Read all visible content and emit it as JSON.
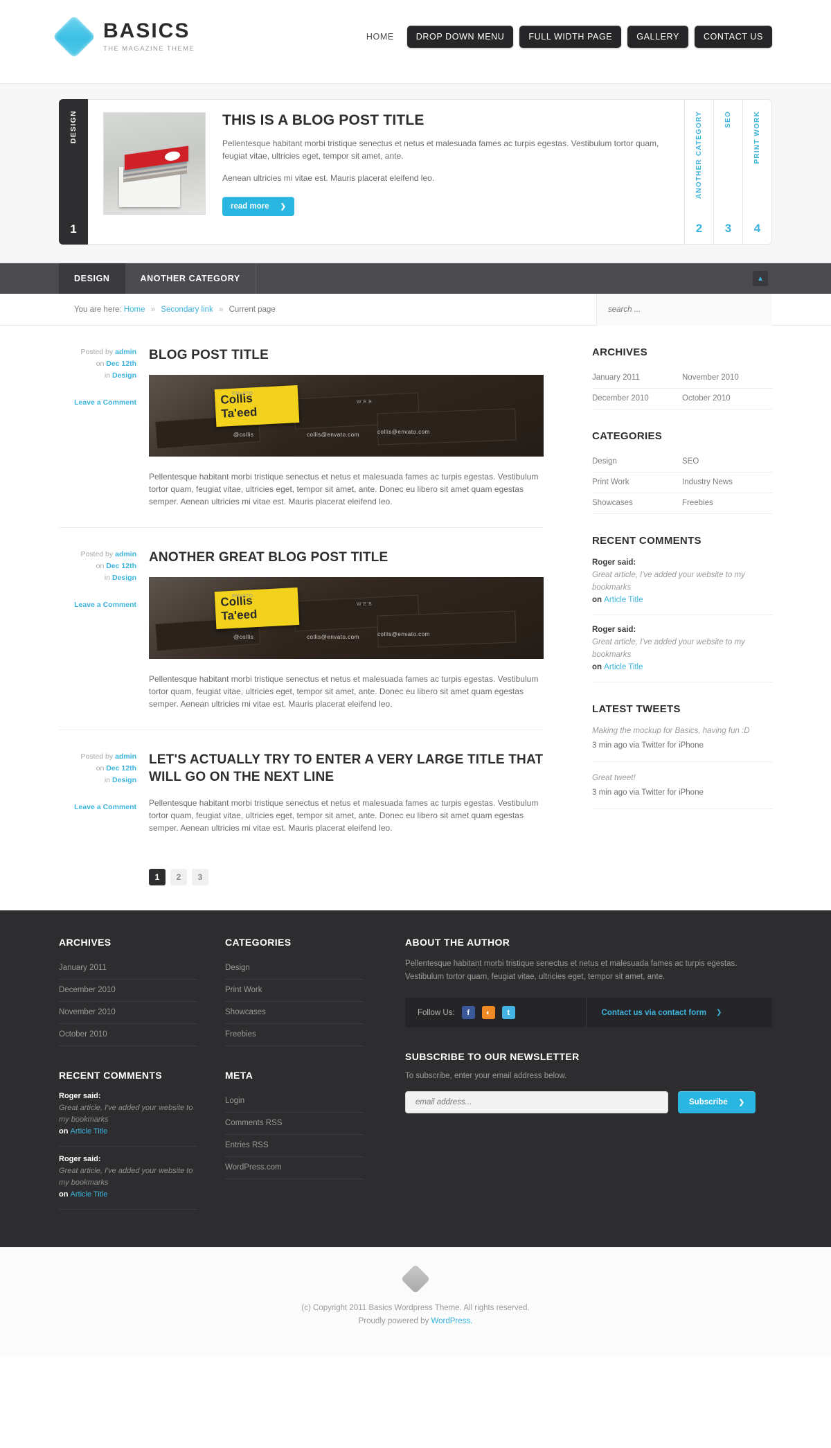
{
  "header": {
    "brand_title": "BASICS",
    "brand_sub": "THE MAGAZINE THEME",
    "logo_icon": "diamond-logo-icon",
    "nav": [
      {
        "label": "HOME",
        "style": "plain"
      },
      {
        "label": "DROP DOWN MENU",
        "style": "button"
      },
      {
        "label": "FULL WIDTH PAGE",
        "style": "button"
      },
      {
        "label": "GALLERY",
        "style": "button"
      },
      {
        "label": "CONTACT US",
        "style": "button"
      }
    ]
  },
  "featured": {
    "active_tab": {
      "label": "DESIGN",
      "number": "1"
    },
    "slide": {
      "title": "THIS IS A BLOG POST TITLE",
      "paragraph1": "Pellentesque habitant morbi tristique senectus et netus et malesuada fames ac turpis egestas. Vestibulum tortor quam, feugiat vitae, ultricies eget, tempor sit amet, ante.",
      "paragraph2": "Aenean ultricies mi vitae est. Mauris placerat eleifend leo.",
      "read_more": "read more",
      "arrow_icon": "chevron-right-icon",
      "thumb_alt": "stack-of-business-cards-image"
    },
    "side_tabs": [
      {
        "label": "ANOTHER CATEGORY",
        "number": "2"
      },
      {
        "label": "SEO",
        "number": "3"
      },
      {
        "label": "PRINT WORK",
        "number": "4"
      }
    ]
  },
  "category_bar": {
    "items": [
      {
        "label": "DESIGN",
        "active": true
      },
      {
        "label": "ANOTHER CATEGORY",
        "active": false
      }
    ],
    "toggle_icon": "chevron-up-icon"
  },
  "breadcrumb": {
    "prefix": "You are here:",
    "home": "Home",
    "secondary": "Secondary link",
    "current": "Current page",
    "separator": "»"
  },
  "search": {
    "placeholder": "search ...",
    "value": "",
    "icon": "search-icon"
  },
  "posts": [
    {
      "meta_posted_by": "Posted by",
      "author": "admin",
      "meta_on": "on",
      "date": "Dec 12th",
      "meta_in": "in",
      "category": "Design",
      "comment_link": "Leave a Comment",
      "title": "BLOG POST TITLE",
      "has_image": true,
      "image_alt": "collis-taeed-business-cards-image",
      "body": "Pellentesque habitant morbi tristique senectus et netus et malesuada fames ac turpis egestas. Vestibulum tortor quam, feugiat vitae, ultricies eget, tempor sit amet, ante. Donec eu libero sit amet quam egestas semper. Aenean ultricies mi vitae est. Mauris placerat eleifend leo."
    },
    {
      "meta_posted_by": "Posted by",
      "author": "admin",
      "meta_on": "on",
      "date": "Dec 12th",
      "meta_in": "in",
      "category": "Design",
      "comment_link": "Leave a Comment",
      "title": "ANOTHER GREAT BLOG POST TITLE",
      "has_image": true,
      "image_alt": "collis-taeed-business-cards-image",
      "body": "Pellentesque habitant morbi tristique senectus et netus et malesuada fames ac turpis egestas. Vestibulum tortor quam, feugiat vitae, ultricies eget, tempor sit amet, ante. Donec eu libero sit amet quam egestas semper. Aenean ultricies mi vitae est. Mauris placerat eleifend leo."
    },
    {
      "meta_posted_by": "Posted by",
      "author": "admin",
      "meta_on": "on",
      "date": "Dec 12th",
      "meta_in": "in",
      "category": "Design",
      "comment_link": "Leave a Comment",
      "title": "LET'S ACTUALLY TRY TO ENTER A VERY LARGE TITLE THAT WILL GO ON THE NEXT LINE",
      "has_image": false,
      "image_alt": "",
      "body": "Pellentesque habitant morbi tristique senectus et netus et malesuada fames ac turpis egestas. Vestibulum tortor quam, feugiat vitae, ultricies eget, tempor sit amet, ante. Donec eu libero sit amet quam egestas semper. Aenean ultricies mi vitae est. Mauris placerat eleifend leo."
    }
  ],
  "pagination": {
    "pages": [
      "1",
      "2",
      "3"
    ],
    "current": "1"
  },
  "sidebar": {
    "archives": {
      "title": "ARCHIVES",
      "items": [
        "January 2011",
        "November 2010",
        "December 2010",
        "October 2010"
      ]
    },
    "categories": {
      "title": "CATEGORIES",
      "items": [
        "Design",
        "SEO",
        "Print Work",
        "Industry News",
        "Showcases",
        "Freebies"
      ]
    },
    "recent_comments": {
      "title": "RECENT COMMENTS",
      "items": [
        {
          "who": "Roger said:",
          "quote": "Great article, I've added your website to my bookmarks",
          "on": "on",
          "article": "Article Title"
        },
        {
          "who": "Roger said:",
          "quote": "Great article, I've added your website to my bookmarks",
          "on": "on",
          "article": "Article Title"
        }
      ]
    },
    "latest_tweets": {
      "title": "LATEST TWEETS",
      "items": [
        {
          "text": "Making the mockup for Basics, having fun :D",
          "meta": "3 min ago via Twitter for iPhone"
        },
        {
          "text": "Great tweet!",
          "meta": "3 min ago via Twitter for iPhone"
        }
      ]
    }
  },
  "footer": {
    "archives": {
      "title": "ARCHIVES",
      "items": [
        "January 2011",
        "December 2010",
        "November 2010",
        "October 2010"
      ]
    },
    "recent_comments": {
      "title": "RECENT COMMENTS",
      "items": [
        {
          "who": "Roger said:",
          "quote": "Great article, I've added your website to my bookmarks",
          "on": "on",
          "article": "Article Title"
        },
        {
          "who": "Roger said:",
          "quote": "Great article, I've added your website to my bookmarks",
          "on": "on",
          "article": "Article Title"
        }
      ]
    },
    "categories": {
      "title": "CATEGORIES",
      "items": [
        "Design",
        "Print Work",
        "Showcases",
        "Freebies"
      ]
    },
    "meta": {
      "title": "META",
      "items": [
        "Login",
        "Comments RSS",
        "Entries RSS",
        "WordPress.com"
      ]
    },
    "about": {
      "title": "ABOUT THE AUTHOR",
      "body": "Pellentesque habitant morbi tristique senectus et netus et malesuada fames ac turpis egestas. Vestibulum tortor quam, feugiat vitae, ultricies eget, tempor sit amet, ante.",
      "follow_label": "Follow Us:",
      "social": [
        {
          "name": "facebook-icon",
          "glyph": "f"
        },
        {
          "name": "rss-icon",
          "glyph": "◔"
        },
        {
          "name": "twitter-icon",
          "glyph": "t"
        }
      ],
      "contact_link": "Contact us via contact form",
      "contact_arrow_icon": "chevron-right-icon"
    },
    "newsletter": {
      "title": "SUBSCRIBE TO OUR NEWSLETTER",
      "note": "To subscribe, enter your email address below.",
      "placeholder": "email address...",
      "value": "",
      "button": "Subscribe",
      "arrow_icon": "chevron-right-icon"
    }
  },
  "copyright": {
    "logo_icon": "diamond-logo-icon",
    "line1": "(c) Copyright 2011 Basics Wordpress Theme. All rights reserved.",
    "line2_prefix": "Proudly powered by ",
    "line2_link": "WordPress."
  },
  "colors": {
    "accent": "#29b6e0",
    "link": "#3cb4dd",
    "dark": "#2d2d30",
    "bar": "#4a4a4f"
  }
}
